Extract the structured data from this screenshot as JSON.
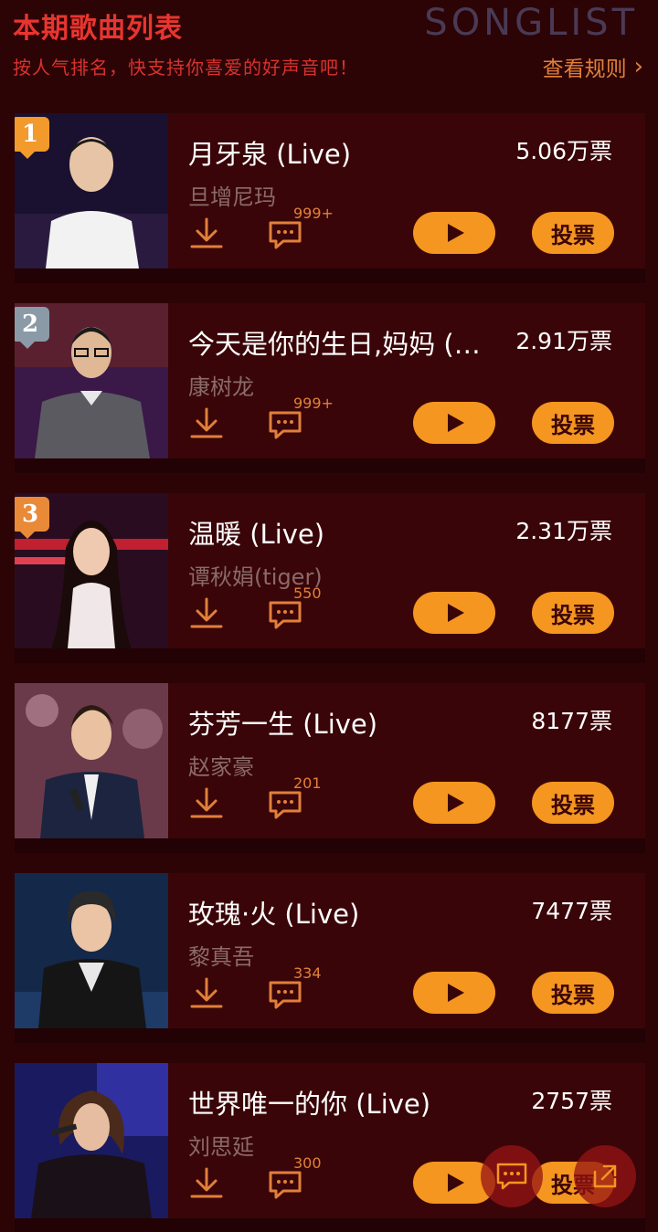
{
  "header": {
    "title": "本期歌曲列表",
    "brand_word": "SONGLIST",
    "subtitle": "按人气排名，快支持你喜爱的好声音吧！",
    "rules_link": "查看规则"
  },
  "colors": {
    "background": "#2c0406",
    "card": "#3a0508",
    "accent": "#f4961f",
    "title_red": "#e8352f",
    "artist_gray": "#8a6a6a"
  },
  "songs": [
    {
      "rank": "1",
      "title": "月牙泉 (Live)",
      "artist": "旦增尼玛",
      "votes": "5.06万票",
      "comments": "999+",
      "vote_label": "投票"
    },
    {
      "rank": "2",
      "title": "今天是你的生日,妈妈 (…",
      "artist": "康树龙",
      "votes": "2.91万票",
      "comments": "999+",
      "vote_label": "投票"
    },
    {
      "rank": "3",
      "title": "温暖 (Live)",
      "artist": "谭秋娟(tiger)",
      "votes": "2.31万票",
      "comments": "550",
      "vote_label": "投票"
    },
    {
      "rank": "",
      "title": "芬芳一生 (Live)",
      "artist": "赵家豪",
      "votes": "8177票",
      "comments": "201",
      "vote_label": "投票"
    },
    {
      "rank": "",
      "title": "玫瑰·火 (Live)",
      "artist": "黎真吾",
      "votes": "7477票",
      "comments": "334",
      "vote_label": "投票"
    },
    {
      "rank": "",
      "title": "世界唯一的你 (Live)",
      "artist": "刘思延",
      "votes": "2757票",
      "comments": "300",
      "vote_label": "投票"
    }
  ],
  "icons": {
    "download": "download-icon",
    "comment": "comment-icon",
    "play": "play-icon",
    "chevron": "chevron-right-icon",
    "float_chat": "chat-bubble-icon",
    "float_share": "share-icon"
  }
}
